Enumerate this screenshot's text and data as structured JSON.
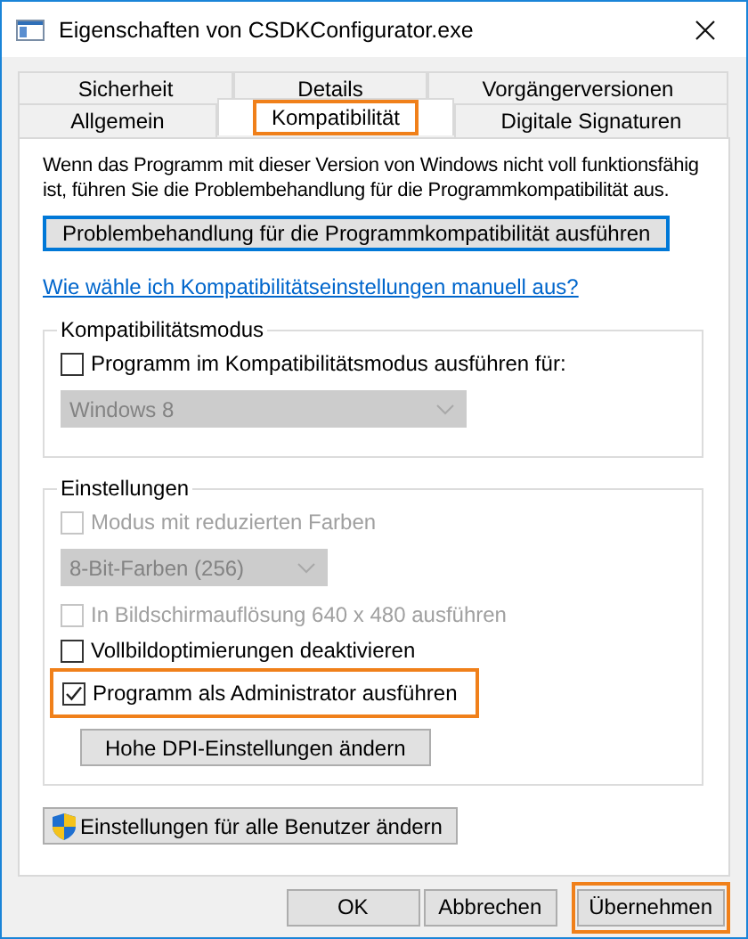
{
  "window": {
    "title": "Eigenschaften von CSDKConfigurator.exe"
  },
  "tab_rows": [
    [
      {
        "label": "Sicherheit",
        "selected": false,
        "highlighted": false
      },
      {
        "label": "Details",
        "selected": false,
        "highlighted": false
      },
      {
        "label": "Vorgängerversionen",
        "selected": false,
        "highlighted": false
      }
    ],
    [
      {
        "label": "Allgemein",
        "selected": false,
        "highlighted": false
      },
      {
        "label": "Kompatibilität",
        "selected": true,
        "highlighted": true
      },
      {
        "label": "Digitale Signaturen",
        "selected": false,
        "highlighted": false
      }
    ]
  ],
  "intro": "Wenn das Programm mit dieser Version von Windows nicht voll funktionsfähig ist, führen Sie die Problembehandlung für die Programmkompatibilität aus.",
  "troubleshoot_button": {
    "label": "Problembehandlung für die Programmkompatibilität ausführen",
    "focused": true
  },
  "help_link": "Wie wähle ich Kompatibilitätseinstellungen manuell aus?",
  "groups": [
    {
      "title": "Kompatibilitätsmodus",
      "items": [
        {
          "kind": "checkbox",
          "label": "Programm im Kompatibilitätsmodus ausführen für:",
          "checked": false,
          "disabled": false,
          "highlighted": false
        },
        {
          "kind": "dropdown",
          "value": "Windows 8",
          "disabled": true
        }
      ]
    },
    {
      "title": "Einstellungen",
      "items": [
        {
          "kind": "checkbox",
          "label": "Modus mit reduzierten Farben",
          "checked": false,
          "disabled": true,
          "highlighted": false
        },
        {
          "kind": "dropdown",
          "value": "8-Bit-Farben (256)",
          "disabled": true
        },
        {
          "kind": "checkbox",
          "label": "In Bildschirmauflösung 640 x 480 ausführen",
          "checked": false,
          "disabled": true,
          "highlighted": false
        },
        {
          "kind": "checkbox",
          "label": "Vollbildoptimierungen deaktivieren",
          "checked": false,
          "disabled": false,
          "highlighted": false
        },
        {
          "kind": "checkbox",
          "label": "Programm als Administrator ausführen",
          "checked": true,
          "disabled": false,
          "highlighted": true
        },
        {
          "kind": "button",
          "label": "Hohe DPI-Einstellungen ändern"
        }
      ]
    }
  ],
  "all_users_button": {
    "label": "Einstellungen für alle Benutzer ändern"
  },
  "buttons": [
    {
      "label": "OK",
      "highlighted": false
    },
    {
      "label": "Abbrechen",
      "highlighted": false
    },
    {
      "label": "Übernehmen",
      "highlighted": true
    }
  ]
}
